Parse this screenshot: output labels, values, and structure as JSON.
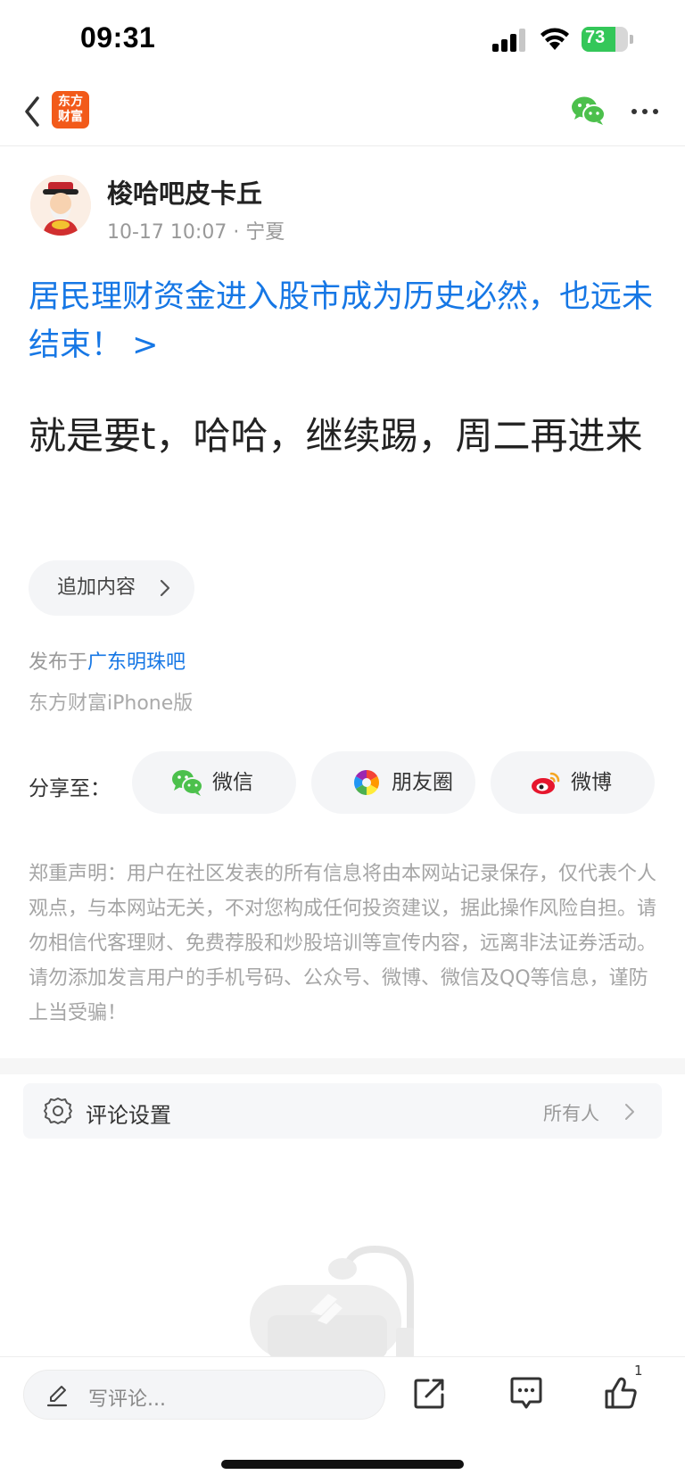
{
  "status_bar": {
    "time": "09:31",
    "battery": "73",
    "battery_level": 0.73
  },
  "nav": {
    "logo_line1": "东方",
    "logo_line2": "财富"
  },
  "author": {
    "name": "梭哈吧皮卡丘",
    "meta": "10-17 10:07 · 宁夏"
  },
  "post": {
    "topic_link": "居民理财资金进入股市成为历史必然，也远未结束！ >",
    "body": "就是要t，哈哈，继续踢，周二再进来",
    "append_label": "追加内容",
    "publish_prefix": "发布于",
    "board": "广东明珠吧",
    "client": "东方财富iPhone版"
  },
  "share": {
    "label": "分享至：",
    "targets": [
      {
        "label": "微信",
        "icon": "wechat-icon"
      },
      {
        "label": "朋友圈",
        "icon": "moments-icon"
      },
      {
        "label": "微博",
        "icon": "weibo-icon"
      }
    ]
  },
  "disclaimer": "郑重声明：用户在社区发表的所有信息将由本网站记录保存，仅代表个人观点，与本网站无关，不对您构成任何投资建议，据此操作风险自担。请勿相信代客理财、免费荐股和炒股培训等宣传内容，远离非法证券活动。请勿添加发言用户的手机号码、公众号、微博、微信及QQ等信息，谨防上当受骗！",
  "comment_settings": {
    "label": "评论设置",
    "value": "所有人"
  },
  "bottom_bar": {
    "placeholder": "写评论...",
    "like_count": "1"
  },
  "colors": {
    "link": "#1677e5",
    "brand": "#f25a1a",
    "wechat": "#4cc04c",
    "weibo": "#e6162d"
  }
}
